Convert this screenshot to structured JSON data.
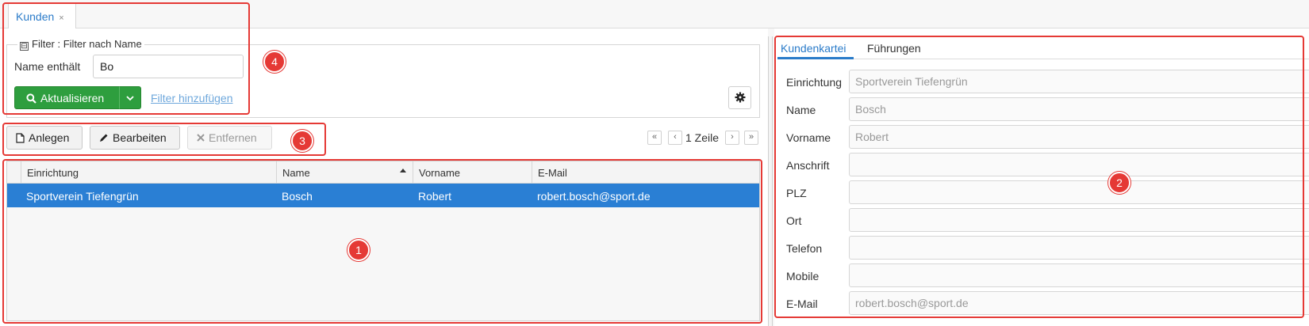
{
  "tabs": [
    {
      "label": "Kunden",
      "close": "×"
    }
  ],
  "filter": {
    "legend": "Filter : Filter nach Name",
    "legend_toggle": "⊟",
    "name_label": "Name enthält",
    "name_value": "Bo",
    "refresh_label": "Aktualisieren",
    "add_filter_label": "Filter hinzufügen"
  },
  "toolbar": {
    "create_label": "Anlegen",
    "edit_label": "Bearbeiten",
    "remove_label": "Entfernen",
    "row_count": "1 Zeile"
  },
  "grid": {
    "columns": [
      "Einrichtung",
      "Name",
      "Vorname",
      "E-Mail"
    ],
    "sort_column": "Name",
    "rows": [
      {
        "einrichtung": "Sportverein Tiefengrün",
        "name": "Bosch",
        "vorname": "Robert",
        "email": "robert.bosch@sport.de"
      }
    ]
  },
  "detail": {
    "tabs": [
      "Kundenkartei",
      "Führungen"
    ],
    "active_tab": "Kundenkartei",
    "fields": [
      {
        "label": "Einrichtung",
        "value": "Sportverein Tiefengrün"
      },
      {
        "label": "Name",
        "value": "Bosch"
      },
      {
        "label": "Vorname",
        "value": "Robert"
      },
      {
        "label": "Anschrift",
        "value": ""
      },
      {
        "label": "PLZ",
        "value": ""
      },
      {
        "label": "Ort",
        "value": ""
      },
      {
        "label": "Telefon",
        "value": ""
      },
      {
        "label": "Mobile",
        "value": ""
      },
      {
        "label": "E-Mail",
        "value": "robert.bosch@sport.de"
      }
    ]
  },
  "annotations": [
    "1",
    "2",
    "3",
    "4"
  ],
  "colors": {
    "accent": "#2a7bc9",
    "selection": "#2a7fd4",
    "success": "#2e9e3e",
    "annotation": "#e53935"
  },
  "icons": [
    "close-icon",
    "search-icon",
    "chevron-down-icon",
    "gear-icon",
    "file-icon",
    "pencil-icon",
    "times-icon",
    "first-page-icon",
    "prev-page-icon",
    "next-page-icon",
    "last-page-icon",
    "sort-asc-icon"
  ]
}
